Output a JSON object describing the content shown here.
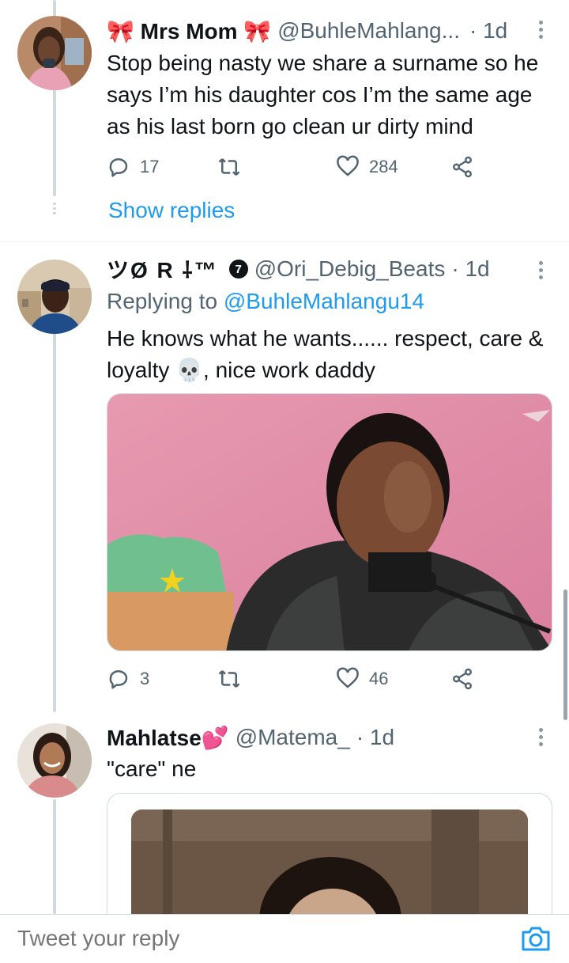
{
  "tweets": [
    {
      "name": "🎀 Mrs Mom 🎀",
      "handle": "@BuhleMahlang...",
      "time": "· 1d",
      "text": "Stop being nasty we share a surname so he says I’m his daughter cos I’m the same age as his last born go clean ur dirty mind",
      "replies": "17",
      "retweets": "",
      "likes": "284",
      "show_replies": "Show replies"
    },
    {
      "name": "ツØ R ⸸™",
      "badge": "7",
      "handle": "@Ori_Debig_Beats",
      "time": "· 1d",
      "replying_label": "Replying to",
      "replying_to": "@BuhleMahlangu14",
      "text": "He knows what he wants...... respect, care & loyalty 💀, nice work daddy",
      "replies": "3",
      "retweets": "",
      "likes": "46"
    },
    {
      "name": "Mahlatse💕",
      "handle": "@Matema_",
      "time": "· 1d",
      "text": "\"care\" ne"
    }
  ],
  "reply_bar": {
    "placeholder": "Tweet your reply"
  },
  "icons": [
    "reply-icon",
    "retweet-icon",
    "like-icon",
    "share-icon",
    "more-icon",
    "camera-icon"
  ],
  "colors": {
    "accent": "#1d9bf0",
    "secondary_text": "#536471",
    "thread_line": "#cfd9de"
  }
}
